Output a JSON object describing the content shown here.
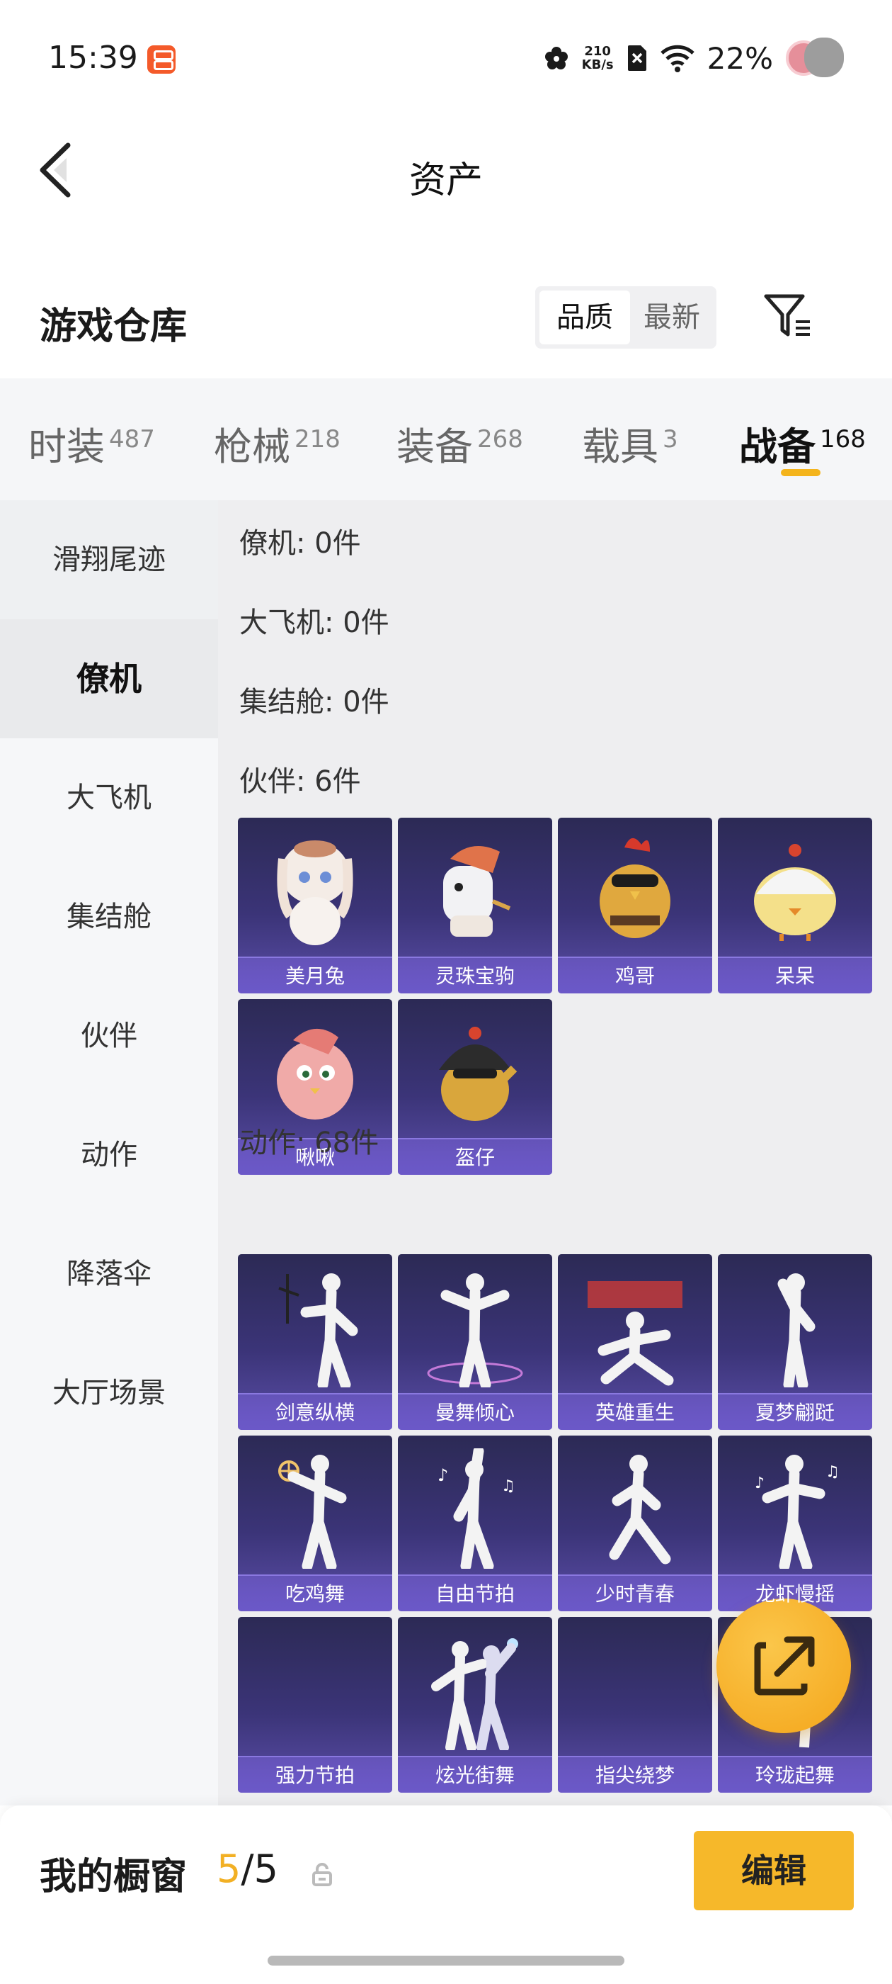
{
  "status_bar": {
    "time": "15:39",
    "net_speed_value": "210",
    "net_speed_unit": "KB/s",
    "battery": "22%",
    "icons": [
      "app-icon",
      "flower-icon",
      "sim-off-icon",
      "wifi-icon",
      "avatar"
    ]
  },
  "nav": {
    "title": "资产",
    "back_icon": "chevron-left-icon"
  },
  "warehouse": {
    "title": "游戏仓库",
    "sort_options": [
      "品质",
      "最新"
    ],
    "sort_selected": "品质",
    "filter_icon": "filter-icon"
  },
  "tabs": [
    {
      "label": "时装",
      "count": "487"
    },
    {
      "label": "枪械",
      "count": "218"
    },
    {
      "label": "装备",
      "count": "268"
    },
    {
      "label": "载具",
      "count": "3"
    },
    {
      "label": "战备",
      "count": "168",
      "active": true
    }
  ],
  "sidebar": {
    "items": [
      "滑翔尾迹",
      "僚机",
      "大飞机",
      "集结舱",
      "伙伴",
      "动作",
      "降落伞",
      "大厅场景"
    ],
    "active": "僚机"
  },
  "sections": {
    "wingman": "僚机: 0件",
    "big_plane": "大飞机: 0件",
    "pod": "集结舱: 0件",
    "partner": "伙伴: 6件",
    "emote": "动作: 68件"
  },
  "partners": [
    "美月兔",
    "灵珠宝驹",
    "鸡哥",
    "呆呆",
    "啾啾",
    "盔仔"
  ],
  "emotes": [
    "剑意纵横",
    "曼舞倾心",
    "英雄重生",
    "夏梦翩跹",
    "吃鸡舞",
    "自由节拍",
    "少时青春",
    "龙虾慢摇",
    "强力节拍",
    "炫光街舞",
    "指尖绕梦",
    "玲珑起舞"
  ],
  "fab_icon": "share-external-icon",
  "showcase": {
    "title": "我的橱窗",
    "count_current": "5",
    "count_sep": "/",
    "count_total": "5",
    "lock_icon": "lock-icon",
    "edit_label": "编辑"
  },
  "colors": {
    "accent": "#f4b41c",
    "card_dark": "#2c2a55",
    "card_bar": "#6b58c8",
    "edit_button": "#f6b82a"
  }
}
